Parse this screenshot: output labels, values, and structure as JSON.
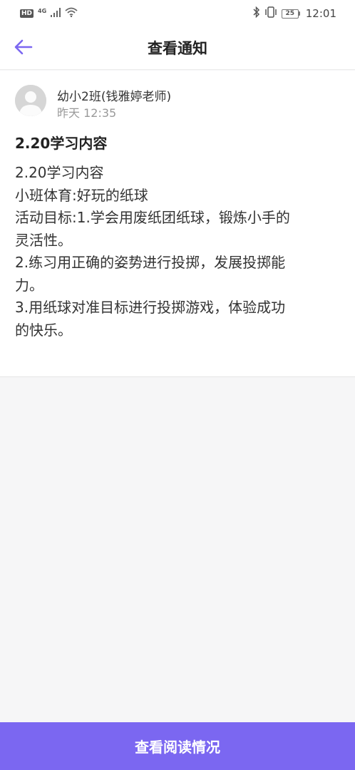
{
  "status_bar": {
    "hd_badge": "HD",
    "network": "4G",
    "battery_level": "25",
    "time": "12:01",
    "icons": [
      "hd-icon",
      "signal-icon",
      "wifi-icon",
      "bluetooth-icon",
      "vibrate-icon",
      "battery-icon"
    ]
  },
  "header": {
    "title": "查看通知",
    "back_icon": "arrow-left-icon",
    "accent_color": "#7b67f1"
  },
  "notice": {
    "sender": "幼小2班(钱雅婷老师)",
    "time": "昨天 12:35",
    "title": "2.20学习内容",
    "lines": [
      "2.20学习内容",
      "小班体育:好玩的纸球",
      "活动目标:1.学会用废纸团纸球，锻炼小手的",
      "灵活性。",
      "2.练习用正确的姿势进行投掷，发展投掷能",
      "力。",
      "3.用纸球对准目标进行投掷游戏，体验成功",
      "的快乐。"
    ]
  },
  "footer": {
    "button_label": "查看阅读情况",
    "button_color": "#7b67f1"
  }
}
